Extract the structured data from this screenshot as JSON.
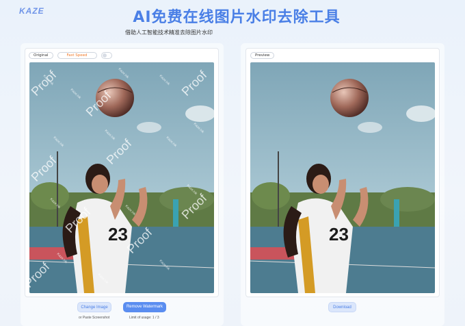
{
  "brand": {
    "logo": "KAZE"
  },
  "header": {
    "title": "AI免费在线图片水印去除工具",
    "subtitle": "借助人工智能技术精准去除图片水印"
  },
  "left_panel": {
    "mode_original": "Original",
    "mode_fast": "Fast Speed",
    "watermark_text": "Proof",
    "watermark_small": "Kaze.ink",
    "change_button": "Change Image",
    "remove_button": "Remove Watermark",
    "paste_hint": "or Paste Screenshot",
    "usage_limit": "Limit of usage: 1 / 3"
  },
  "right_panel": {
    "preview_label": "Preview",
    "download_button": "Download"
  },
  "colors": {
    "accent": "#4a7fe6",
    "primary_button": "#5a8df0",
    "fast_speed": "#f07a2a"
  }
}
